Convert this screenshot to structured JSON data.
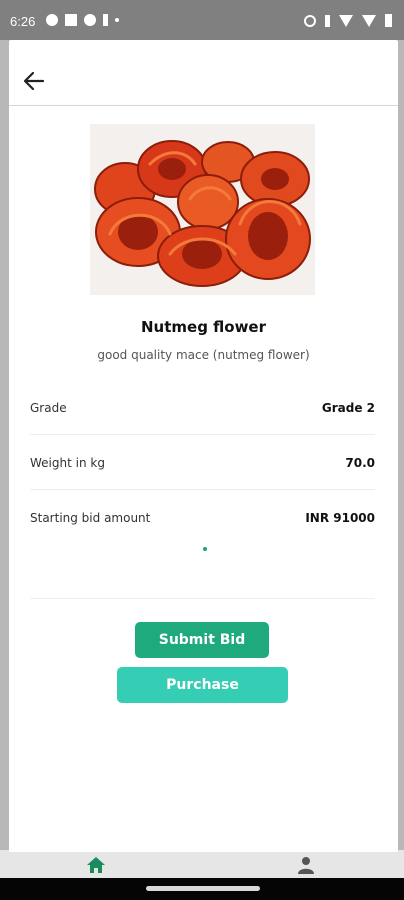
{
  "status_bar": {
    "time": "6:26"
  },
  "product": {
    "title": "Nutmeg flower",
    "description": "good quality mace (nutmeg flower)"
  },
  "details": [
    {
      "label": "Grade",
      "value": "Grade 2"
    },
    {
      "label": "Weight in kg",
      "value": "70.0"
    },
    {
      "label": "Starting bid amount",
      "value": "INR 91000"
    }
  ],
  "actions": {
    "submit_bid_label": "Submit Bid",
    "purchase_label": "Purchase"
  },
  "colors": {
    "primary": "#1faa7e",
    "secondary": "#35cdb3",
    "nav_active": "#1b8c5e"
  },
  "icons": {
    "back": "arrow-left-icon",
    "nav_home": "home-icon",
    "nav_profile": "person-icon"
  }
}
